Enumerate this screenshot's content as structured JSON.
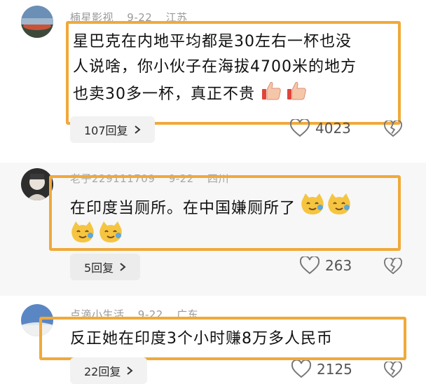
{
  "comments": [
    {
      "username": "楠星影视",
      "date": "9-22",
      "location": "江苏",
      "lines": [
        "星巴克在内地平均都是30左右一杯也没",
        "人说啥，你小伙子在海拔4700米的地方",
        "也卖30多一杯，真正不贵"
      ],
      "emojis": [
        "thumbs-up-emoji",
        "thumbs-up-emoji"
      ],
      "reply_label": "107回复",
      "likes": "4023"
    },
    {
      "username": "老子229111709",
      "date": "9-22",
      "location": "四川",
      "lines": [
        "在印度当厕所。在中国嫌厕所了"
      ],
      "emojis": [
        "smiling-cat-emoji",
        "smiling-cat-emoji",
        "smiling-cat-emoji",
        "smiling-cat-emoji"
      ],
      "reply_label": "5回复",
      "likes": "263"
    },
    {
      "username": "点滴小生活",
      "date": "9-22",
      "location": "广东",
      "lines": [
        "反正她在印度3个小时赚8万多人民币"
      ],
      "emojis": [],
      "reply_label": "22回复",
      "likes": "2125"
    }
  ],
  "colors": {
    "highlight_border": "#f0a93a",
    "meta_text": "#9a9a9a"
  },
  "icons": {
    "like": "heart-outline-icon",
    "dislike": "broken-heart-icon",
    "reply": "chevron-right-icon"
  }
}
